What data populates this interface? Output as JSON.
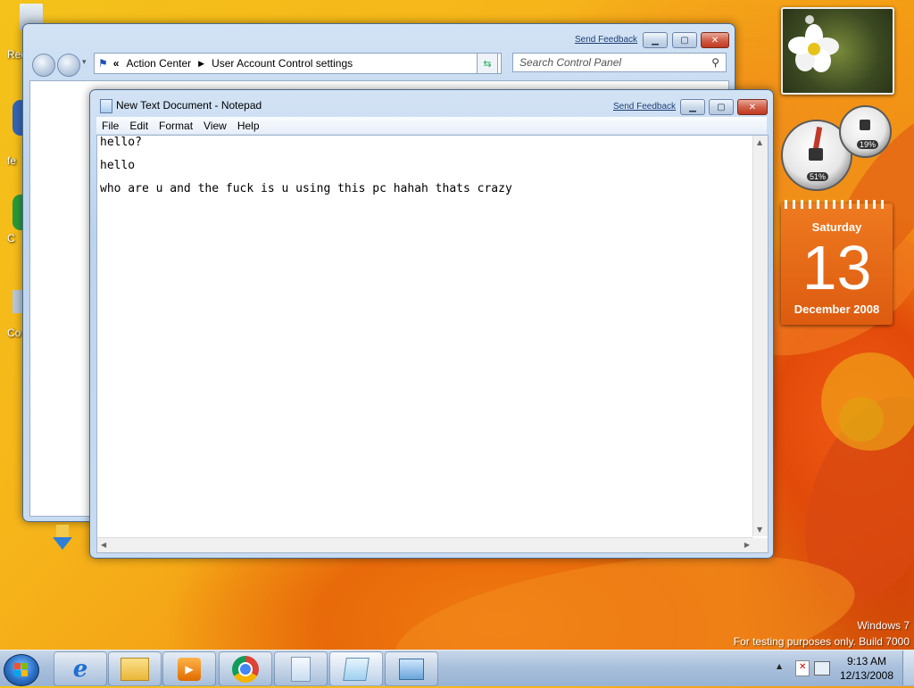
{
  "control_panel": {
    "send_feedback": "Send Feedback",
    "breadcrumb_chevron": "«",
    "breadcrumb": [
      "Action Center",
      "User Account Control settings"
    ],
    "search_placeholder": "Search Control Panel"
  },
  "notepad": {
    "title": "New Text Document - Notepad",
    "send_feedback": "Send Feedback",
    "menu": [
      "File",
      "Edit",
      "Format",
      "View",
      "Help"
    ],
    "lines": [
      "hello?",
      "hello",
      "who are u and the fuck is u using this pc hahah thats crazy"
    ]
  },
  "gadgets": {
    "cpu_percent": "51%",
    "memory_percent": "19%",
    "calendar": {
      "weekday": "Saturday",
      "day": "13",
      "month_year": "December 2008"
    }
  },
  "watermark": {
    "line1": "Windows 7",
    "line2": "For testing purposes only. Build 7000"
  },
  "taskbar": {
    "time": "9:13 AM",
    "date": "12/13/2008",
    "apps": [
      "internet-explorer",
      "windows-explorer",
      "media-player",
      "chrome",
      "notepad-file",
      "notepad",
      "control-panel"
    ]
  }
}
